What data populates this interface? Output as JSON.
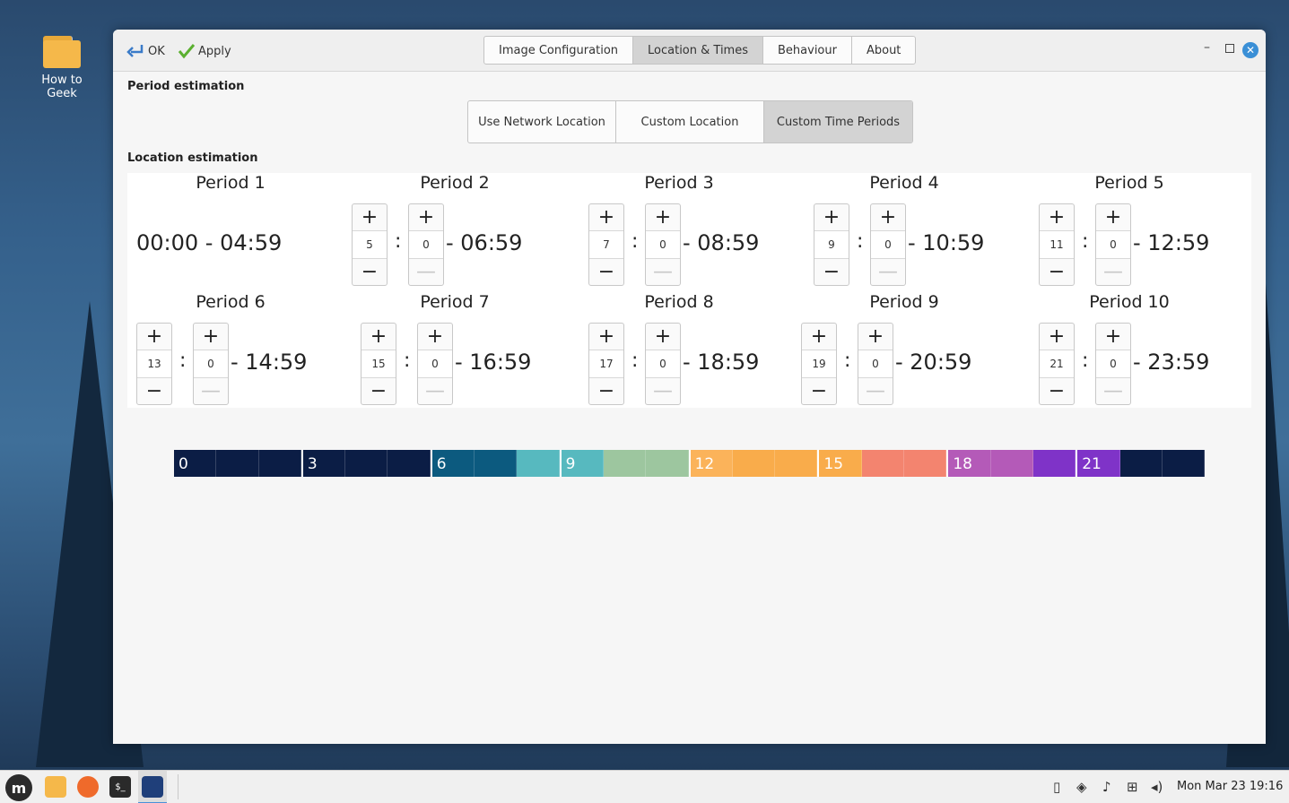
{
  "desktop": {
    "folder_label": "How to Geek"
  },
  "toolbar": {
    "ok_label": "OK",
    "apply_label": "Apply"
  },
  "tabs": [
    {
      "label": "Image Configuration"
    },
    {
      "label": "Location & Times"
    },
    {
      "label": "Behaviour"
    },
    {
      "label": "About"
    }
  ],
  "period_estimation": {
    "heading": "Period estimation",
    "options": [
      {
        "label": "Use Network Location"
      },
      {
        "label": "Custom Location"
      },
      {
        "label": "Custom Time Periods"
      }
    ],
    "selected": "Custom Time Periods"
  },
  "location_estimation": {
    "heading": "Location estimation"
  },
  "periods": [
    {
      "title": "Period 1",
      "static": "00:00 - 04:59"
    },
    {
      "title": "Period 2",
      "hour": "5",
      "minute": "0",
      "end": "- 06:59"
    },
    {
      "title": "Period 3",
      "hour": "7",
      "minute": "0",
      "end": "- 08:59"
    },
    {
      "title": "Period 4",
      "hour": "9",
      "minute": "0",
      "end": "- 10:59"
    },
    {
      "title": "Period 5",
      "hour": "11",
      "minute": "0",
      "end": "- 12:59"
    },
    {
      "title": "Period 6",
      "hour": "13",
      "minute": "0",
      "end": "- 14:59"
    },
    {
      "title": "Period 7",
      "hour": "15",
      "minute": "0",
      "end": "- 16:59"
    },
    {
      "title": "Period 8",
      "hour": "17",
      "minute": "0",
      "end": "- 18:59"
    },
    {
      "title": "Period 9",
      "hour": "19",
      "minute": "0",
      "end": "- 20:59"
    },
    {
      "title": "Period 10",
      "hour": "21",
      "minute": "0",
      "end": "- 23:59"
    }
  ],
  "spin_symbols": {
    "plus": "+",
    "minus": "−",
    "minus_disabled": "—",
    "colon": ":"
  },
  "timeline": {
    "labels": [
      "0",
      "3",
      "6",
      "9",
      "12",
      "15",
      "18",
      "21"
    ],
    "colors": [
      "#0b1d45",
      "#0b1d45",
      "#0b1d45",
      "#0b1d45",
      "#0b1d45",
      "#0b1d45",
      "#0c5a7f",
      "#0c5a7f",
      "#57b9bf",
      "#57b9bf",
      "#9dc69f",
      "#9dc69f",
      "#fbb35a",
      "#f9ac4b",
      "#f9ac4b",
      "#f9ac4b",
      "#f3846f",
      "#f3846f",
      "#b45ab8",
      "#b45ab8",
      "#7f33c8",
      "#7f33c8",
      "#0b1d45",
      "#0b1d45"
    ]
  },
  "taskbar": {
    "clock": "Mon Mar 23 19:16"
  }
}
